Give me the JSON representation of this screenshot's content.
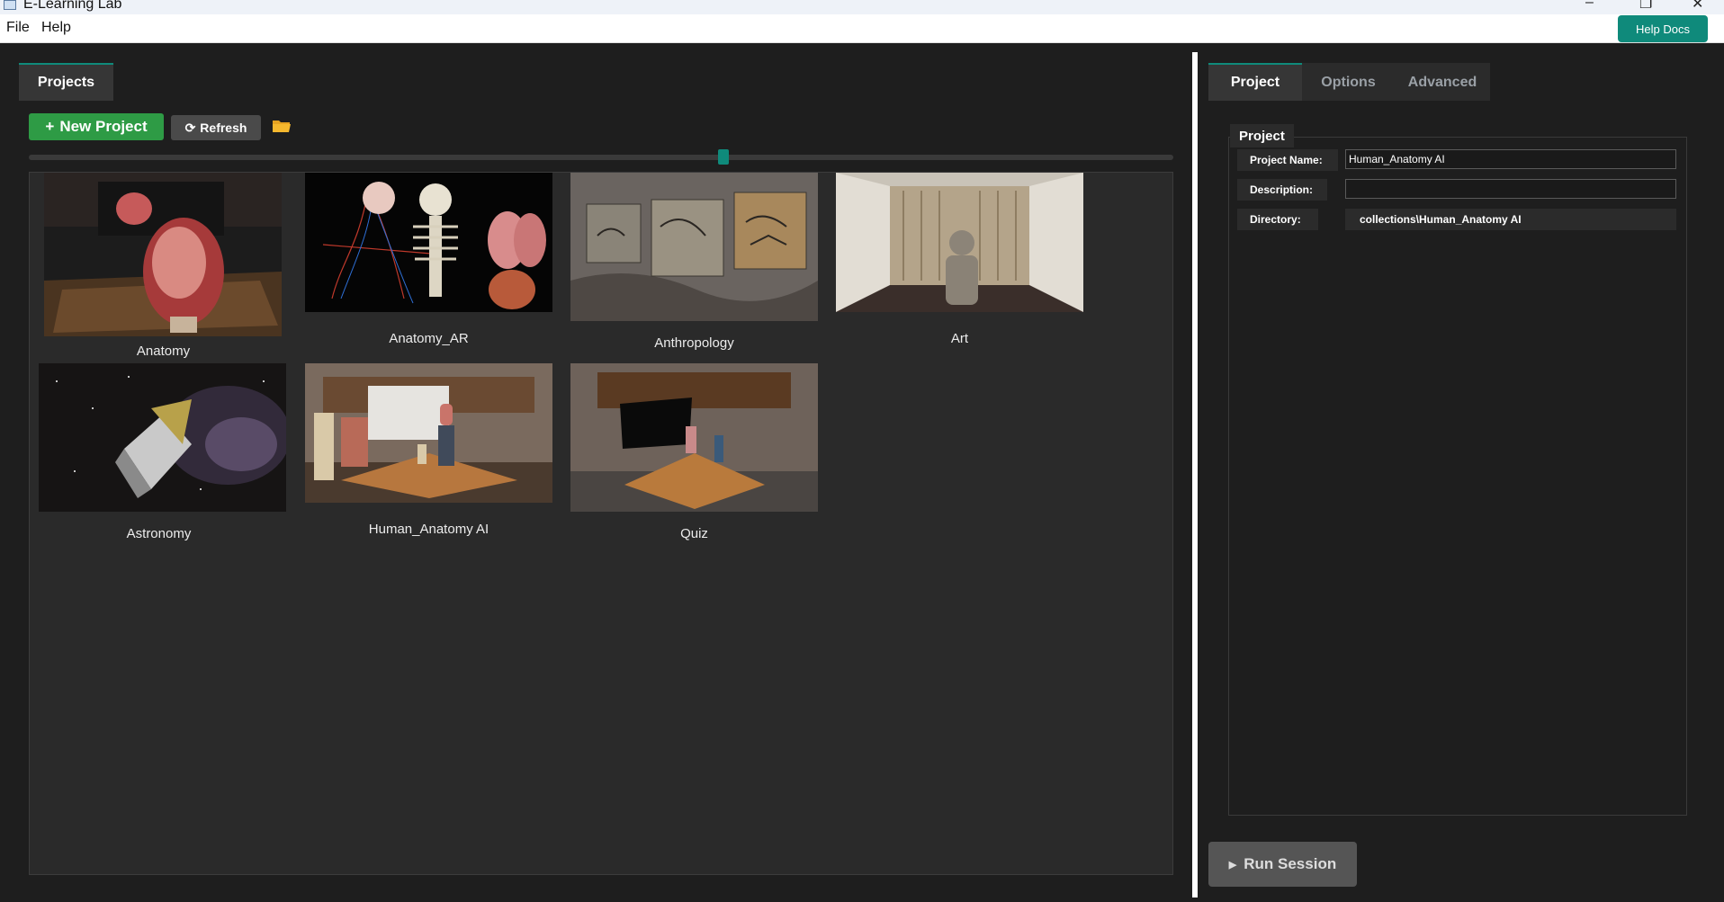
{
  "window": {
    "title": "E-Learning Lab"
  },
  "menu": {
    "items": [
      "File",
      "Help"
    ],
    "help_docs": "Help Docs"
  },
  "left": {
    "tab": "Projects",
    "new_project": "New Project",
    "refresh": "Refresh",
    "projects": [
      {
        "name": "Anatomy"
      },
      {
        "name": "Anatomy_AR"
      },
      {
        "name": "Anthropology"
      },
      {
        "name": "Art"
      },
      {
        "name": "Astronomy"
      },
      {
        "name": "Human_Anatomy AI"
      },
      {
        "name": "Quiz"
      }
    ]
  },
  "right": {
    "tabs": [
      "Project",
      "Options",
      "Advanced"
    ],
    "group_title": "Project",
    "fields": {
      "project_name_label": "Project Name:",
      "project_name_value": "Human_Anatomy AI",
      "description_label": "Description:",
      "description_value": "",
      "directory_label": "Directory:",
      "directory_value": "collections\\Human_Anatomy AI"
    },
    "run_session": "Run Session"
  },
  "colors": {
    "accent": "#0f8a7b",
    "new_project_green": "#2e9b45",
    "background": "#1e1e1e"
  }
}
